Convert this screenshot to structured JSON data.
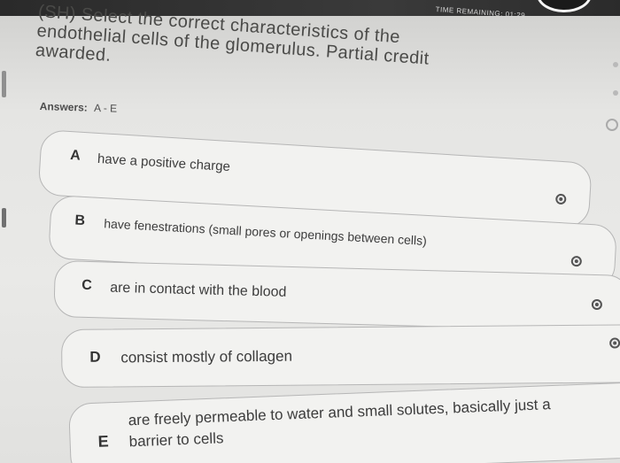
{
  "header": {
    "timer_label": "TIME REMAINING: 01:29"
  },
  "question": {
    "line_1": "(SH) Select the correct characteristics of the",
    "line_2": "endothelial cells of the glomerulus. Partial credit",
    "line_3": "awarded."
  },
  "answers": {
    "label": "Answers:",
    "value": "A - E"
  },
  "options": [
    {
      "letter": "A",
      "text": "have a positive charge"
    },
    {
      "letter": "B",
      "text": "have fenestrations (small pores or openings between cells)"
    },
    {
      "letter": "C",
      "text": "are in contact with the blood"
    },
    {
      "letter": "D",
      "text": "consist mostly of collagen"
    },
    {
      "letter": "E",
      "text_line_1": "are freely permeable to water and small solutes, basically just a",
      "text_line_2": "barrier to cells"
    }
  ]
}
